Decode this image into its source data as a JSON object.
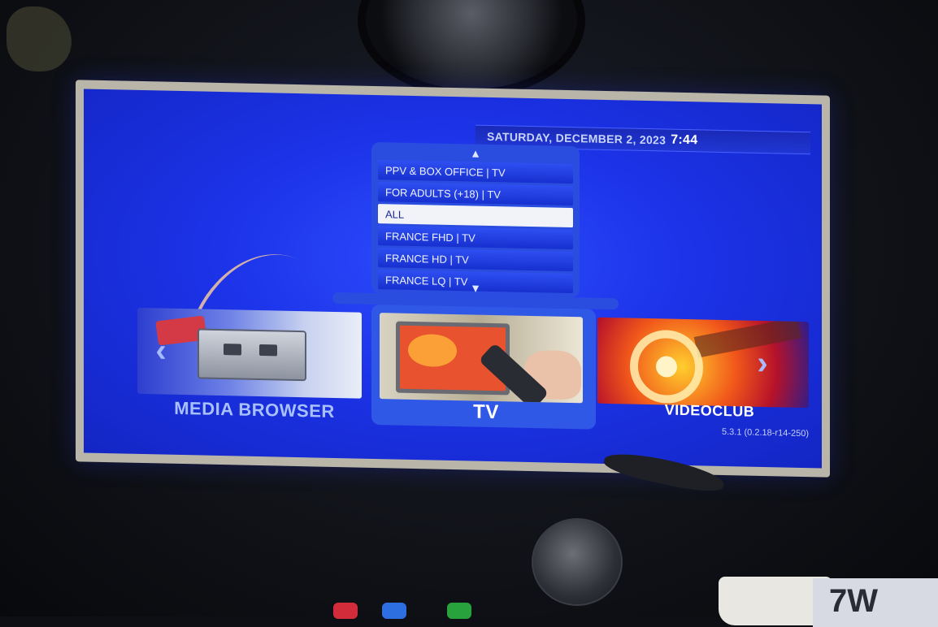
{
  "status_bar": {
    "date": "SATURDAY, DECEMBER 2, 2023",
    "time": "7:44"
  },
  "category_menu": {
    "items": [
      {
        "label": "PPV & BOX OFFICE | TV",
        "selected": false
      },
      {
        "label": "FOR ADULTS (+18) | TV",
        "selected": false
      },
      {
        "label": "ALL",
        "selected": true
      },
      {
        "label": "FRANCE FHD | TV",
        "selected": false
      },
      {
        "label": "FRANCE HD | TV",
        "selected": false
      },
      {
        "label": "FRANCE LQ | TV",
        "selected": false
      }
    ],
    "scroll_up_icon": "chevron-up-icon",
    "scroll_down_icon": "chevron-down-icon"
  },
  "carousel": {
    "tiles": [
      {
        "label": "MEDIA BROWSER",
        "focused": false
      },
      {
        "label": "TV",
        "focused": true
      },
      {
        "label": "VIDEOCLUB",
        "focused": false
      }
    ],
    "prev_icon": "chevron-left-icon",
    "next_icon": "chevron-right-icon"
  },
  "version": "5.3.1 (0.2.18-r14-250)",
  "background_sign": "7W",
  "colors": {
    "screen_blue": "#1c33e8",
    "menu_panel": "#2a4de0",
    "selected_item": "#f2f3f8"
  }
}
